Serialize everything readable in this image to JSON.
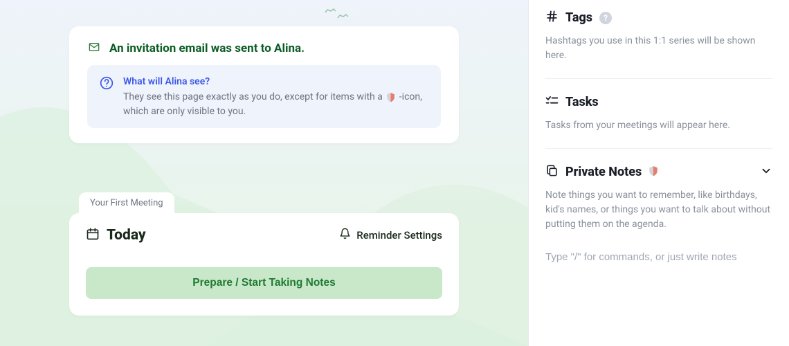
{
  "main": {
    "invite": {
      "header": "An invitation email was sent to Alina.",
      "info_title": "What will Alina see?",
      "info_body_pre": "They see this page exactly as you do, except for items with a ",
      "info_body_post": " -icon, which are only visible to you."
    },
    "meeting": {
      "tab_label": "Your First Meeting",
      "title": "Today",
      "reminder_label": "Reminder Settings",
      "prepare_label": "Prepare / Start Taking Notes"
    }
  },
  "sidebar": {
    "tags": {
      "title": "Tags",
      "desc": "Hashtags you use in this 1:1 series will be shown here."
    },
    "tasks": {
      "title": "Tasks",
      "desc": "Tasks from your meetings will appear here."
    },
    "private": {
      "title": "Private Notes",
      "desc": "Note things you want to remember, like birthdays, kid's names, or things you want to talk about without putting them on the agenda.",
      "placeholder": "Type \"/\" for commands, or just write notes"
    },
    "help_glyph": "?"
  }
}
